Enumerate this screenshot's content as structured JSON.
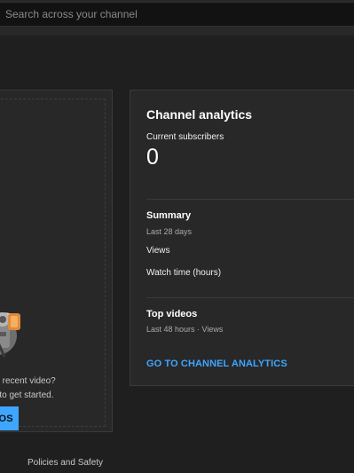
{
  "search": {
    "placeholder": "Search across your channel"
  },
  "upload_card": {
    "prompt_line1": "ur recent video?",
    "prompt_line2": "o to get started.",
    "button_label": "EOS"
  },
  "analytics": {
    "title": "Channel analytics",
    "subscribers_label": "Current subscribers",
    "subscribers_count": "0",
    "summary": {
      "title": "Summary",
      "period": "Last 28 days",
      "metrics": [
        "Views",
        "Watch time (hours)"
      ]
    },
    "top_videos": {
      "title": "Top videos",
      "period": "Last 48 hours · Views"
    },
    "link_label": "GO TO CHANNEL ANALYTICS"
  },
  "footer": {
    "policies_label": "Policies and Safety"
  },
  "colors": {
    "accent": "#3ea6ff",
    "background": "#1f1f1f",
    "card": "#282828"
  }
}
